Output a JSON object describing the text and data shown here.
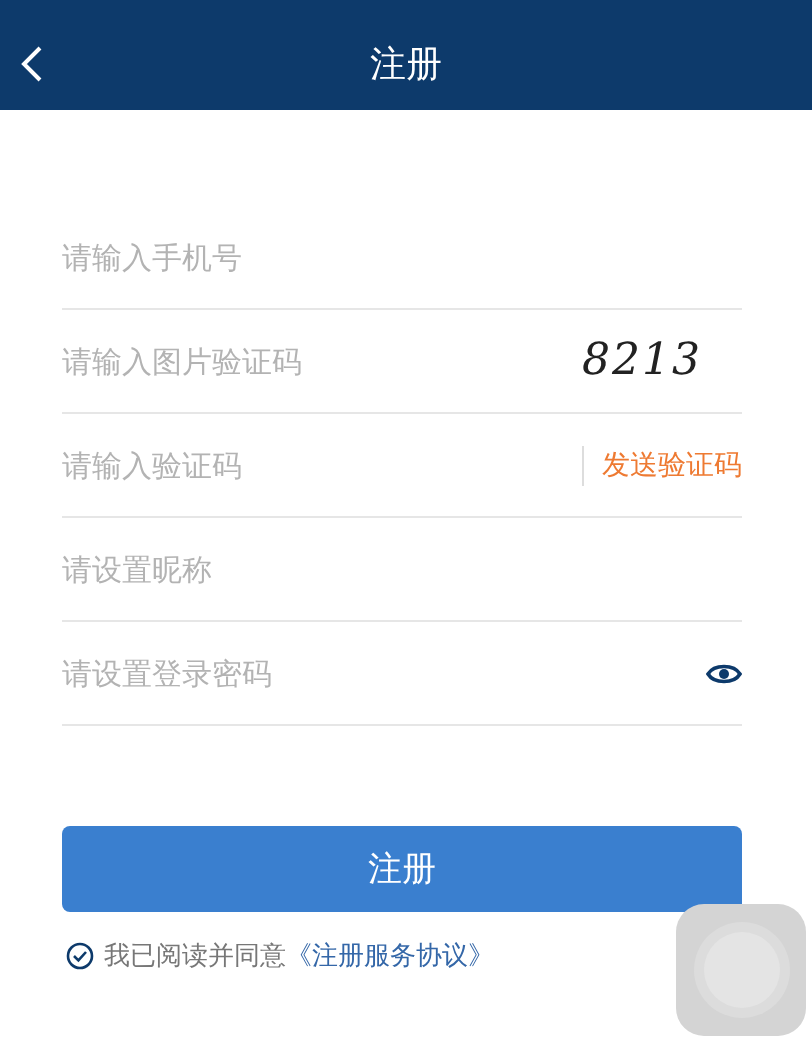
{
  "header": {
    "title": "注册"
  },
  "fields": [
    {
      "kind": "text",
      "placeholder": "请输入手机号"
    },
    {
      "kind": "captcha",
      "placeholder": "请输入图片验证码",
      "captcha": "8213"
    },
    {
      "kind": "sms",
      "placeholder": "请输入验证码",
      "action": "发送验证码"
    },
    {
      "kind": "text",
      "placeholder": "请设置昵称"
    },
    {
      "kind": "password",
      "placeholder": "请设置登录密码"
    }
  ],
  "submit": "注册",
  "agreement": {
    "checked": true,
    "text": "我已阅读并同意",
    "link": "《注册服务协议》"
  }
}
